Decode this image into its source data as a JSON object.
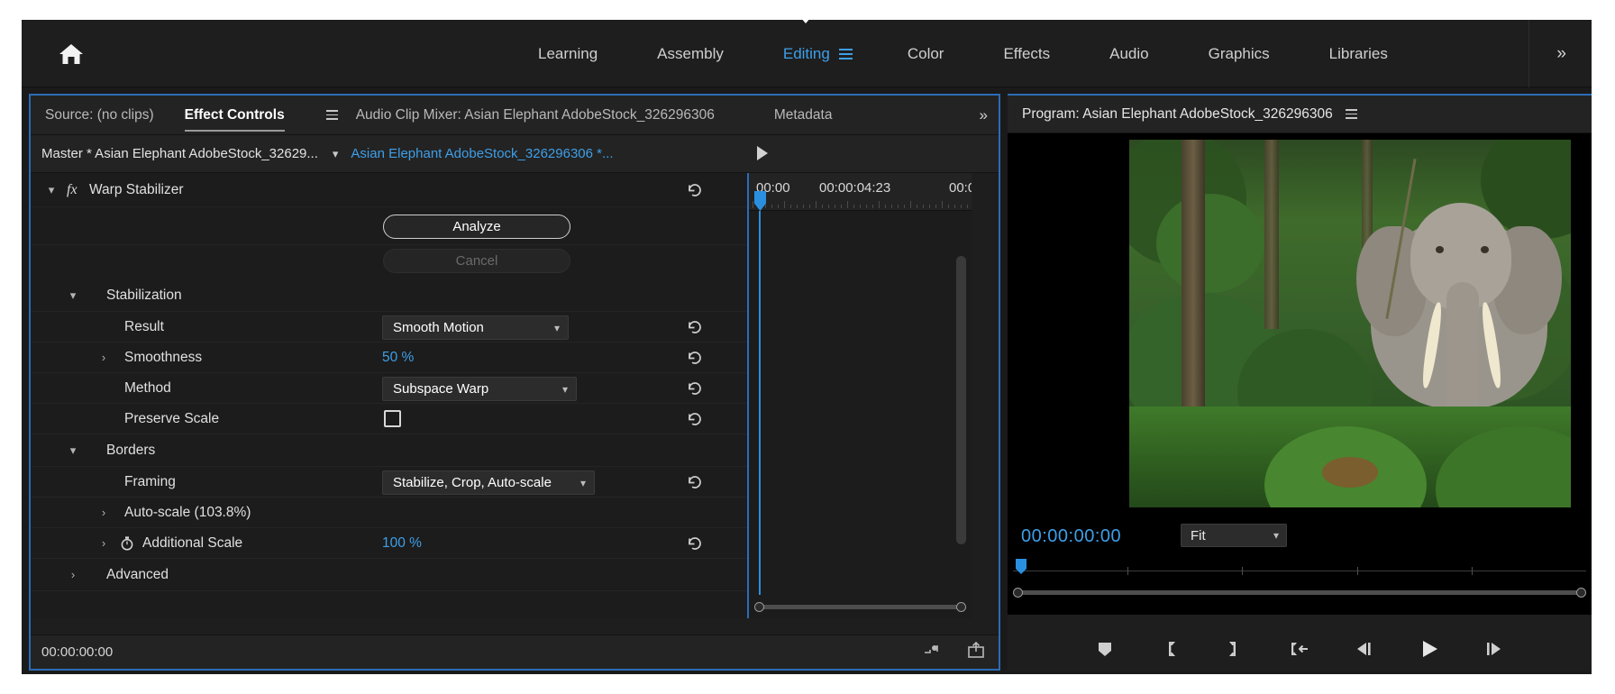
{
  "workspace": {
    "home_icon": "home-icon",
    "tabs": [
      {
        "label": "Learning",
        "active": false
      },
      {
        "label": "Assembly",
        "active": false
      },
      {
        "label": "Editing",
        "active": true
      },
      {
        "label": "Color",
        "active": false
      },
      {
        "label": "Effects",
        "active": false
      },
      {
        "label": "Audio",
        "active": false
      },
      {
        "label": "Graphics",
        "active": false
      },
      {
        "label": "Libraries",
        "active": false
      }
    ],
    "overflow": "»"
  },
  "effect_controls": {
    "tabs": [
      {
        "label": "Source: (no clips)",
        "active": false
      },
      {
        "label": "Effect Controls",
        "active": true
      },
      {
        "label": "Audio Clip Mixer: Asian Elephant AdobeStock_326296306",
        "active": false
      },
      {
        "label": "Metadata",
        "active": false
      }
    ],
    "overflow": "»",
    "master_label": "Master * Asian Elephant AdobeStock_32629...",
    "clip_label": "Asian Elephant AdobeStock_326296306 *...",
    "effect_name": "Warp Stabilizer",
    "fx_badge": "fx",
    "analyze_label": "Analyze",
    "cancel_label": "Cancel",
    "groups": {
      "stabilization": "Stabilization",
      "borders": "Borders",
      "advanced": "Advanced"
    },
    "params": {
      "result_label": "Result",
      "result_value": "Smooth Motion",
      "smoothness_label": "Smoothness",
      "smoothness_value": "50 %",
      "method_label": "Method",
      "method_value": "Subspace Warp",
      "preserve_scale_label": "Preserve Scale",
      "preserve_scale_checked": false,
      "framing_label": "Framing",
      "framing_value": "Stabilize, Crop, Auto-scale",
      "autoscale_label": "Auto-scale (103.8%)",
      "additional_scale_label": "Additional Scale",
      "additional_scale_value": "100 %"
    },
    "ruler": {
      "labels": [
        "00:00",
        "00:00:04:23",
        "00:0"
      ]
    },
    "status_timecode": "00:00:00:00"
  },
  "program_monitor": {
    "title": "Program: Asian Elephant AdobeStock_326296306",
    "menu_icon": "panel-menu-icon",
    "timecode": "00:00:00:00",
    "zoom_level": "Fit",
    "transport_buttons": [
      {
        "name": "add-marker-button",
        "icon": "marker-icon"
      },
      {
        "name": "mark-in-button",
        "icon": "mark-in-icon"
      },
      {
        "name": "mark-out-button",
        "icon": "mark-out-icon"
      },
      {
        "name": "go-to-in-button",
        "icon": "go-to-in-icon"
      },
      {
        "name": "step-back-button",
        "icon": "step-back-icon"
      },
      {
        "name": "play-stop-button",
        "icon": "play-icon"
      },
      {
        "name": "step-forward-button",
        "icon": "step-forward-icon"
      }
    ]
  },
  "colors": {
    "accent_blue": "#3e9fe8",
    "panel_border": "#2b6cb5",
    "panel_bg": "#1e1e1e",
    "row_bg": "#1c1c1c"
  }
}
